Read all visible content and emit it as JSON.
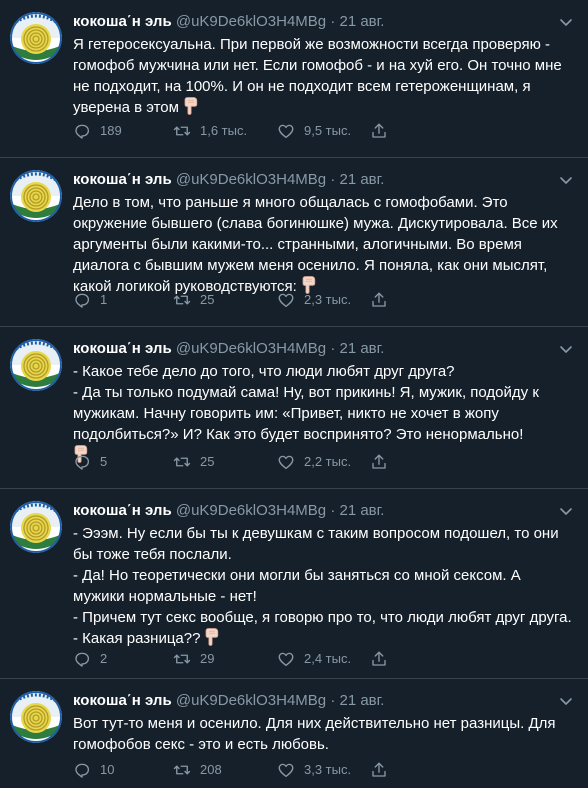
{
  "colors": {
    "background": "#15202b",
    "divider": "#38444d",
    "text": "#ffffff",
    "secondary": "#8899a6"
  },
  "tweets": [
    {
      "name": "кокоша΄н эль",
      "handle": "@uK9De6klO3H4MBg",
      "dot": "·",
      "date": "21 авг.",
      "text": "Я гетеросексуальна. При первой же возможности всегда проверяю - гомофоб мужчина или нет. Если гомофоб - и на хуй его. Он точно мне не подходит, на 100%. И он не подходит всем гетероженщинам, я уверена в этом",
      "emoji": "pointing-down-emoji",
      "replies": "189",
      "retweets": "1,6 тыс.",
      "likes": "9,5 тыс."
    },
    {
      "name": "кокоша΄н эль",
      "handle": "@uK9De6klO3H4MBg",
      "dot": "·",
      "date": "21 авг.",
      "text": "Дело в том, что раньше я много общалась с гомофобами. Это окружение бывшего (слава богинюшке) мужа. Дискутировала. Все их аргументы были какими-то... странными, алогичными. Во время диалога с бывшим мужем меня осенило. Я поняла, как они мыслят, какой логикой руководствуются:",
      "emoji": "pointing-down-emoji",
      "replies": "1",
      "retweets": "25",
      "likes": "2,3 тыс."
    },
    {
      "name": "кокоша΄н эль",
      "handle": "@uK9De6klO3H4MBg",
      "dot": "·",
      "date": "21 авг.",
      "text": "- Какое тебе дело до того, что люди любят друг друга?\n- Да ты только подумай сама! Ну, вот прикинь! Я, мужик, подойду к мужикам. Начну говорить им: «Привет, никто не хочет в жопу подолбиться?» И? Как это будет воспринято? Это ненормально!",
      "emoji": "pointing-down-emoji",
      "replies": "5",
      "retweets": "25",
      "likes": "2,2 тыс."
    },
    {
      "name": "кокоша΄н эль",
      "handle": "@uK9De6klO3H4MBg",
      "dot": "·",
      "date": "21 авг.",
      "text": "- Эээм. Ну если бы ты к девушкам с таким вопросом подошел, то они бы тоже тебя послали.\n- Да! Но теоретически они могли бы заняться со мной сексом. А мужики нормальные - нет!\n- Причем тут секс вообще, я говорю про то, что люди любят друг друга.\n- Какая разница??",
      "emoji": "pointing-down-emoji",
      "replies": "2",
      "retweets": "29",
      "likes": "2,4 тыс."
    },
    {
      "name": "кокоша΄н эль",
      "handle": "@uK9De6klO3H4MBg",
      "dot": "·",
      "date": "21 авг.",
      "text": "Вот тут-то меня и осенило. Для них действительно нет разницы. Для гомофобов секс - это и есть любовь.",
      "emoji": "",
      "replies": "10",
      "retweets": "208",
      "likes": "3,3 тыс."
    }
  ]
}
